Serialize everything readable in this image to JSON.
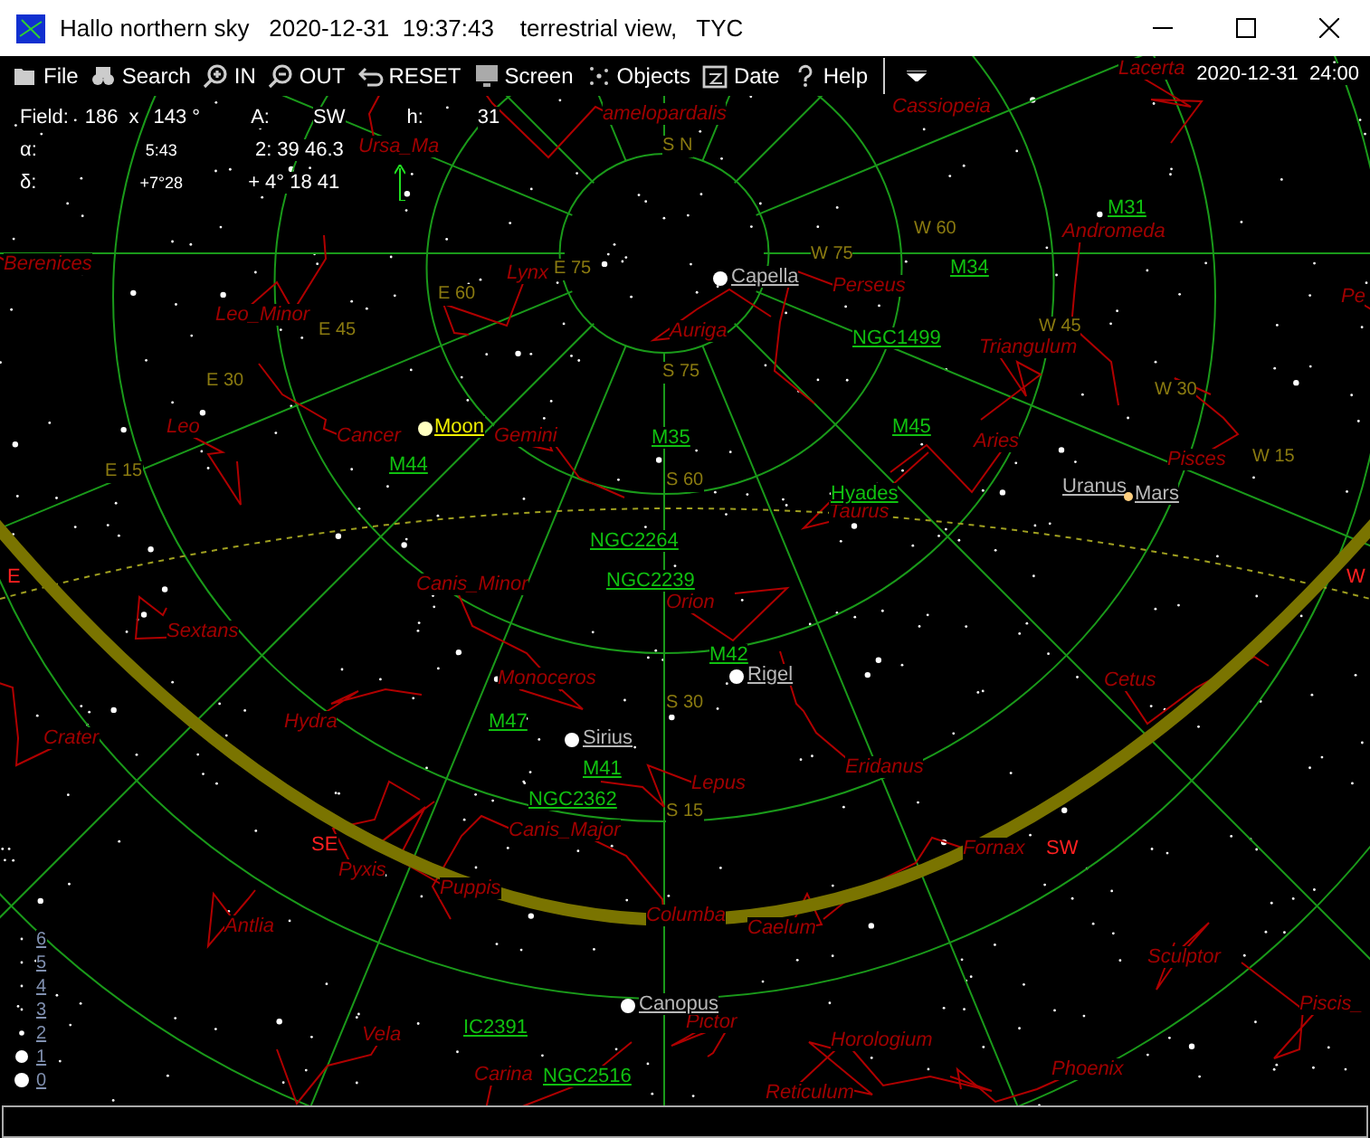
{
  "window": {
    "title": "Hallo northern sky   2020-12-31  19:37:43    terrestrial view,   TYC"
  },
  "toolbar": [
    {
      "label": "File",
      "kind": "file"
    },
    {
      "label": "Search",
      "kind": "search"
    },
    {
      "label": "IN",
      "kind": "zoomin"
    },
    {
      "label": "OUT",
      "kind": "zoomout"
    },
    {
      "label": "RESET",
      "kind": "reset"
    },
    {
      "label": "Screen",
      "kind": "screen"
    },
    {
      "label": "Objects",
      "kind": "objects"
    },
    {
      "label": "Date",
      "kind": "date"
    },
    {
      "label": "Help",
      "kind": "help"
    },
    {
      "kind": "more"
    }
  ],
  "clock": {
    "date": "2020-12-31",
    "time": "24:00"
  },
  "info": {
    "field_label": "Field:",
    "field_w": "186",
    "field_x": "x",
    "field_h": "143 °",
    "az_label": "A:",
    "az": "SW",
    "h_label": "h:",
    "h": "31",
    "ra_label": "α:",
    "ra_small": "5:43",
    "ra": "2: 39 46.3",
    "dec_label": "δ:",
    "dec_small": "+7°28",
    "dec": "+ 4° 18 41"
  },
  "constellations": [
    "Lacerta",
    "amelopardalis",
    "Cassiopeia",
    "Ursa_Ma",
    "Berenices",
    "Leo_Minor",
    "Lynx",
    "Leo",
    "Cancer",
    "Gemini",
    "Auriga",
    "Perseus",
    "Andromeda",
    "Triangulum",
    "Aries",
    "Pisces",
    "Pe",
    "Taurus",
    "Orion",
    "Canis_Minor",
    "Sextans",
    "Monoceros",
    "Hydra",
    "Crater",
    "Lepus",
    "Eridanus",
    "Cetus",
    "Canis_Major",
    "Pyxis",
    "Puppis",
    "Antlia",
    "Columba",
    "Caelum",
    "Fornax",
    "Sculptor",
    "Piscis_",
    "Vela",
    "Pictor",
    "Horologium",
    "Phoenix",
    "Carina",
    "Reticulum"
  ],
  "objects": [
    {
      "label": "M31",
      "kind": "deep_sky"
    },
    {
      "label": "M34",
      "kind": "deep_sky"
    },
    {
      "label": "NGC1499",
      "kind": "deep_sky"
    },
    {
      "label": "M45",
      "kind": "deep_sky"
    },
    {
      "label": "M35",
      "kind": "deep_sky"
    },
    {
      "label": "M44",
      "kind": "deep_sky"
    },
    {
      "label": "NGC2264",
      "kind": "deep_sky"
    },
    {
      "label": "NGC2239",
      "kind": "deep_sky"
    },
    {
      "label": "M42",
      "kind": "deep_sky"
    },
    {
      "label": "M47",
      "kind": "deep_sky"
    },
    {
      "label": "M41",
      "kind": "deep_sky"
    },
    {
      "label": "NGC2362",
      "kind": "deep_sky"
    },
    {
      "label": "IC2391",
      "kind": "deep_sky"
    },
    {
      "label": "NGC2516",
      "kind": "deep_sky"
    },
    {
      "label": "Hyades",
      "kind": "deep_sky"
    },
    {
      "label": "Capella",
      "kind": "star"
    },
    {
      "label": "Rigel",
      "kind": "star"
    },
    {
      "label": "Sirius",
      "kind": "star"
    },
    {
      "label": "Canopus",
      "kind": "star"
    },
    {
      "label": "Moon",
      "kind": "moon"
    },
    {
      "label": "Uranus",
      "kind": "planet"
    },
    {
      "label": "Mars",
      "kind": "planet"
    }
  ],
  "grid_labels": [
    "S N",
    "S 75",
    "S 60",
    "S 30",
    "S 15",
    "E 75",
    "E 60",
    "E 45",
    "E 30",
    "E 15",
    "W 75",
    "W 60",
    "W 45",
    "W 30",
    "W 15"
  ],
  "horizon_marks": [
    "E",
    "SE",
    "SW",
    "W"
  ],
  "magnitude_scale": [
    "6",
    "5",
    "4",
    "3",
    "2",
    "1",
    "0"
  ]
}
